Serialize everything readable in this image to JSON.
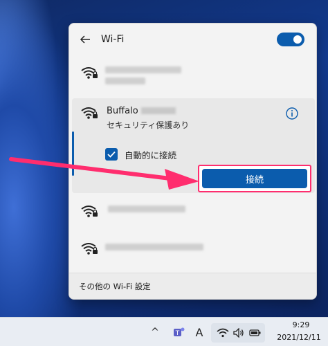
{
  "header": {
    "title": "Wi-Fi",
    "wifi_toggle": "on"
  },
  "selected_network": {
    "ssid": "Buffalo",
    "security": "セキュリティ保護あり",
    "auto_connect_label": "自動的に接続",
    "auto_connect_checked": true,
    "connect_label": "接続"
  },
  "footer": {
    "settings_link": "その他の Wi-Fi 設定"
  },
  "taskbar": {
    "chevron": "^",
    "ime": "A",
    "time": "9:29",
    "date": "2021/12/11"
  },
  "colors": {
    "accent": "#0b5cad",
    "annotation": "#ff2d6e"
  }
}
